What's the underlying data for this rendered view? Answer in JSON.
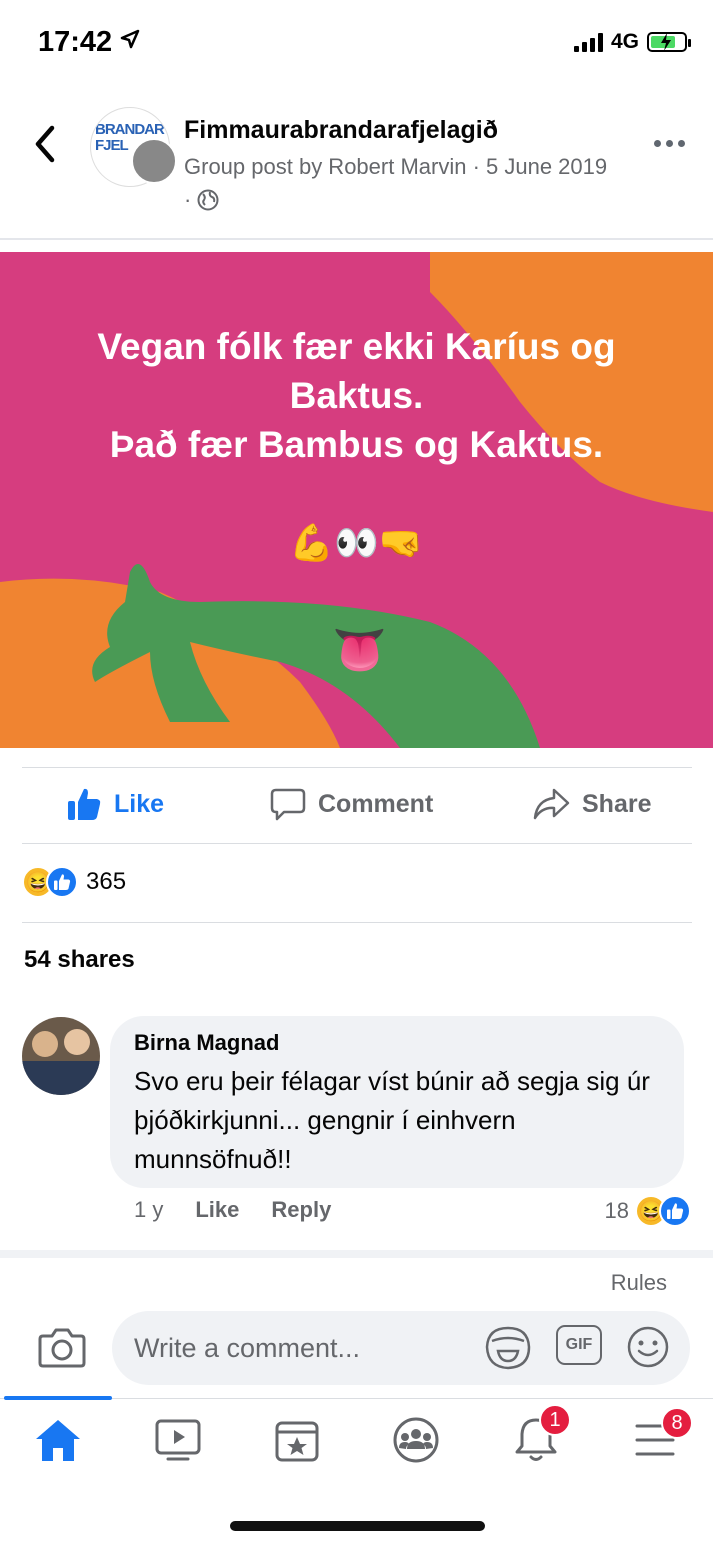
{
  "status_bar": {
    "time": "17:42",
    "network": "4G",
    "icons": [
      "location-arrow-icon",
      "signal-icon",
      "battery-charging-icon"
    ]
  },
  "header": {
    "back_icon": "chevron-left-icon",
    "group_name": "Fimmaurabrandarafjelagið",
    "post_meta_line": "Group post by Robert Marvin · 5 June 2019 ·",
    "privacy_icon": "globe-icon",
    "more_icon": "more-horizontal-icon",
    "avatar_text": "BRANDAR FJEL"
  },
  "post": {
    "image_text_line1": "Vegan fólk fær ekki Karíus og",
    "image_text_line2": "Baktus.",
    "image_text_line3": "Það fær Bambus og Kaktus.",
    "emoji_row": "💪👀🤜",
    "tongue_emoji": "👅",
    "colors": {
      "background": "#d63d7f",
      "orange": "#f08431",
      "green": "#4a9a55"
    }
  },
  "actions": {
    "like_label": "Like",
    "comment_label": "Comment",
    "share_label": "Share"
  },
  "reactions": {
    "count": "365",
    "types": [
      "haha",
      "like"
    ]
  },
  "shares_label": "54 shares",
  "comment": {
    "author": "Birna Magnad",
    "text": "Svo eru þeir félagar víst búnir að segja sig úr þjóðkirkjunni... gengnir í einhvern munnsöfnuð!!",
    "age": "1 y",
    "like_label": "Like",
    "reply_label": "Reply",
    "reaction_count": "18"
  },
  "rules_label": "Rules",
  "composer": {
    "placeholder": "Write a comment...",
    "gif_label": "GIF"
  },
  "tab_bar": {
    "items": [
      {
        "name": "home",
        "icon": "home-icon",
        "active": true
      },
      {
        "name": "watch",
        "icon": "video-icon"
      },
      {
        "name": "pages",
        "icon": "pages-icon"
      },
      {
        "name": "groups",
        "icon": "groups-icon"
      },
      {
        "name": "notifications",
        "icon": "bell-icon",
        "badge": "1"
      },
      {
        "name": "menu",
        "icon": "menu-icon",
        "badge": "8"
      }
    ]
  },
  "accent_color": "#1877f2"
}
